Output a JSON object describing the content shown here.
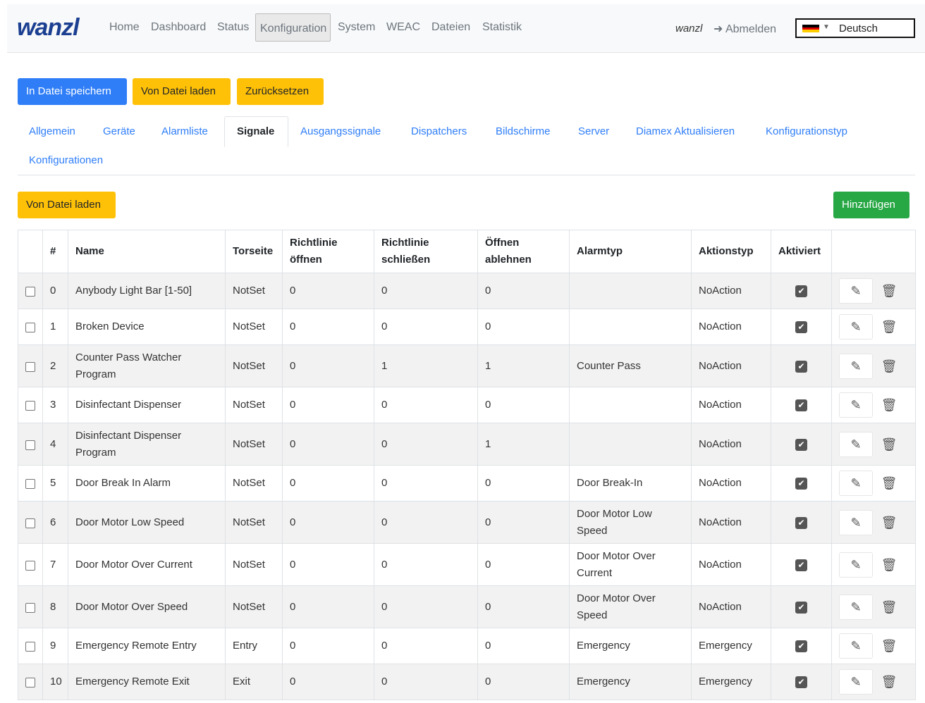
{
  "brand": "wanzl",
  "nav": [
    "Home",
    "Dashboard",
    "Status",
    "Konfiguration",
    "System",
    "WEAC",
    "Dateien",
    "Statistik"
  ],
  "user": "wanzl",
  "logout": "Abmelden",
  "language": "Deutsch",
  "buttons": {
    "save": "In Datei speichern",
    "load": "Von Datei laden",
    "reset": "Zurücksetzen",
    "load2": "Von Datei laden",
    "add": "Hinzufügen"
  },
  "tabs": [
    "Allgemein",
    "Geräte",
    "Alarmliste",
    "Signale",
    "Ausgangssignale",
    "Dispatchers",
    "Bildschirme",
    "Server",
    "Diamex Aktualisieren",
    "Konfigurationstyp",
    "Konfigurationen"
  ],
  "columns": {
    "num": "#",
    "name": "Name",
    "torseite": "Torseite",
    "open": "Richtlinie öffnen",
    "close": "Richtlinie schließen",
    "deny": "Öffnen ablehnen",
    "alarm": "Alarmtyp",
    "action": "Aktionstyp",
    "active": "Aktiviert"
  },
  "rows": [
    {
      "n": "0",
      "name": "Anybody Light Bar [1-50]",
      "side": "NotSet",
      "o": "0",
      "c": "0",
      "d": "0",
      "alarm": "",
      "action": "NoAction"
    },
    {
      "n": "1",
      "name": "Broken Device",
      "side": "NotSet",
      "o": "0",
      "c": "0",
      "d": "0",
      "alarm": "",
      "action": "NoAction"
    },
    {
      "n": "2",
      "name": "Counter Pass Watcher Program",
      "side": "NotSet",
      "o": "0",
      "c": "1",
      "d": "1",
      "alarm": "Counter Pass",
      "action": "NoAction"
    },
    {
      "n": "3",
      "name": "Disinfectant Dispenser",
      "side": "NotSet",
      "o": "0",
      "c": "0",
      "d": "0",
      "alarm": "",
      "action": "NoAction"
    },
    {
      "n": "4",
      "name": "Disinfectant Dispenser Program",
      "side": "NotSet",
      "o": "0",
      "c": "0",
      "d": "1",
      "alarm": "",
      "action": "NoAction"
    },
    {
      "n": "5",
      "name": "Door Break In Alarm",
      "side": "NotSet",
      "o": "0",
      "c": "0",
      "d": "0",
      "alarm": "Door Break-In",
      "action": "NoAction"
    },
    {
      "n": "6",
      "name": "Door Motor Low Speed",
      "side": "NotSet",
      "o": "0",
      "c": "0",
      "d": "0",
      "alarm": "Door Motor Low Speed",
      "action": "NoAction"
    },
    {
      "n": "7",
      "name": "Door Motor Over Current",
      "side": "NotSet",
      "o": "0",
      "c": "0",
      "d": "0",
      "alarm": "Door Motor Over Current",
      "action": "NoAction"
    },
    {
      "n": "8",
      "name": "Door Motor Over Speed",
      "side": "NotSet",
      "o": "0",
      "c": "0",
      "d": "0",
      "alarm": "Door Motor Over Speed",
      "action": "NoAction"
    },
    {
      "n": "9",
      "name": "Emergency Remote Entry",
      "side": "Entry",
      "o": "0",
      "c": "0",
      "d": "0",
      "alarm": "Emergency",
      "action": "Emergency"
    },
    {
      "n": "10",
      "name": "Emergency Remote Exit",
      "side": "Exit",
      "o": "0",
      "c": "0",
      "d": "0",
      "alarm": "Emergency",
      "action": "Emergency"
    }
  ]
}
